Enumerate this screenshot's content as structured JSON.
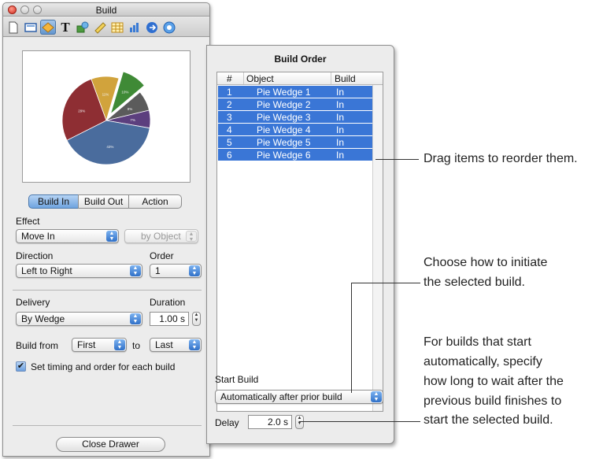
{
  "inspector": {
    "title": "Build",
    "toolbar_icons": [
      "document-icon",
      "slide-icon",
      "build-icon",
      "text-icon",
      "graphic-icon",
      "metrics-icon",
      "table-icon",
      "chart-icon",
      "hyperlink-icon",
      "quicktime-icon"
    ],
    "tabs": [
      {
        "label": "Build In",
        "active": true
      },
      {
        "label": "Build Out",
        "active": false
      },
      {
        "label": "Action",
        "active": false
      }
    ],
    "effect_label": "Effect",
    "effect_value": "Move In",
    "effect_sub_value": "by Object",
    "direction_label": "Direction",
    "direction_value": "Left to Right",
    "order_label": "Order",
    "order_value": "1",
    "delivery_label": "Delivery",
    "delivery_value": "By Wedge",
    "duration_label": "Duration",
    "duration_value": "1.00 s",
    "build_from_label": "Build from",
    "build_from_value": "First",
    "to_label": "to",
    "to_value": "Last",
    "timing_checkbox_label": "Set timing and order for each build",
    "timing_checked": true,
    "close_drawer_label": "Close Drawer"
  },
  "preview_chart": {
    "slices": [
      {
        "label": "11%",
        "value": 11,
        "color": "#d1a33c"
      },
      {
        "label": "10%",
        "value": 10,
        "color": "#3f8a36"
      },
      {
        "label": "8%",
        "value": 8,
        "color": "#5b5b5b"
      },
      {
        "label": "7%",
        "value": 7,
        "color": "#5c3f7e"
      },
      {
        "label": "43%",
        "value": 43,
        "color": "#4a6c9d"
      },
      {
        "label": "29%",
        "value": 29,
        "color": "#8e2e33"
      }
    ]
  },
  "drawer": {
    "title": "Build Order",
    "columns": [
      "#",
      "Object",
      "Build"
    ],
    "rows": [
      {
        "num": "1",
        "object": "Pie Wedge 1",
        "build": "In"
      },
      {
        "num": "2",
        "object": "Pie Wedge 2",
        "build": "In"
      },
      {
        "num": "3",
        "object": "Pie Wedge 3",
        "build": "In"
      },
      {
        "num": "4",
        "object": "Pie Wedge 4",
        "build": "In"
      },
      {
        "num": "5",
        "object": "Pie Wedge 5",
        "build": "In"
      },
      {
        "num": "6",
        "object": "Pie Wedge 6",
        "build": "In"
      }
    ],
    "start_build_label": "Start Build",
    "start_build_value": "Automatically after prior build",
    "delay_label": "Delay",
    "delay_value": "2.0 s"
  },
  "callouts": {
    "reorder": "Drag items to reorder them.",
    "initiate_1": "Choose how to initiate",
    "initiate_2": "the selected build.",
    "delay_1": "For builds that start",
    "delay_2": "automatically, specify",
    "delay_3": "how long to wait after the",
    "delay_4": "previous build finishes to",
    "delay_5": "start the selected build."
  },
  "colors": {
    "selection": "#3a76d6",
    "accent": "#5f93cd"
  }
}
